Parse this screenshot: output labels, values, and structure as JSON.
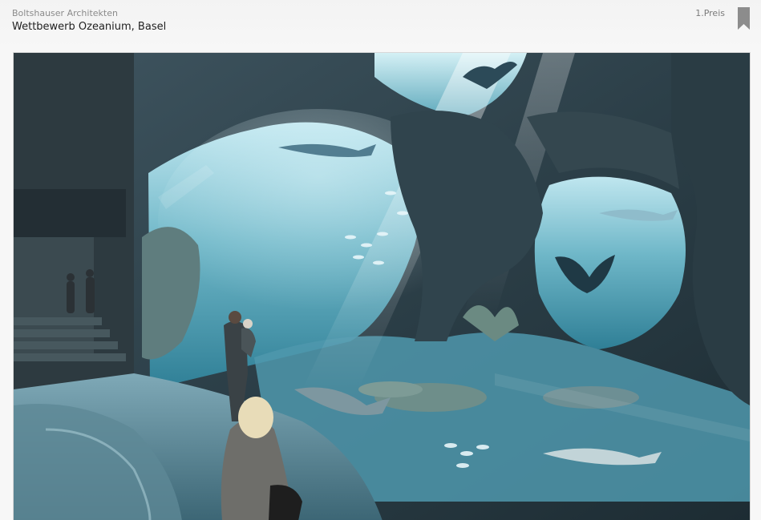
{
  "header": {
    "architect": "Boltshauser Architekten",
    "title": "Wettbewerb Ozeanium, Basel",
    "award": "1.Preis"
  },
  "icons": {
    "bookmark": "bookmark-icon"
  },
  "colors": {
    "bookmark": "#8c8c8c",
    "title_text": "#1f1f1f",
    "meta_text": "#8a8a8a"
  }
}
